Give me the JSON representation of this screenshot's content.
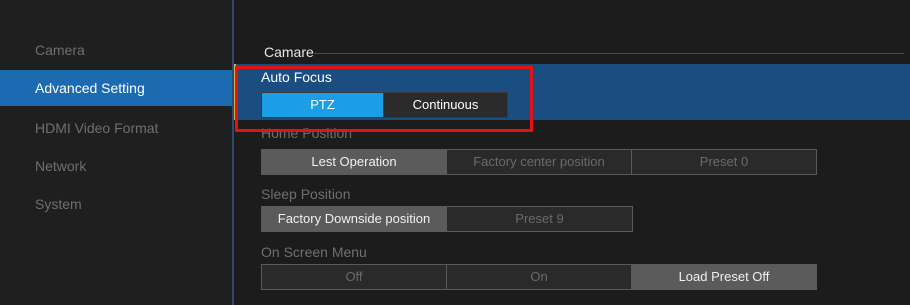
{
  "sidebar": {
    "items": [
      {
        "label": "Camera"
      },
      {
        "label": "Advanced Setting"
      },
      {
        "label": "HDMI Video Format"
      },
      {
        "label": "Network"
      },
      {
        "label": "System"
      }
    ]
  },
  "main": {
    "section_title": "Camare",
    "auto_focus": {
      "label": "Auto Focus",
      "options": [
        "PTZ",
        "Continuous"
      ],
      "selected": "PTZ"
    },
    "home_position": {
      "label": "Home Position",
      "options": [
        "Lest Operation",
        "Factory center position",
        "Preset  0"
      ],
      "selected": "Lest Operation"
    },
    "sleep_position": {
      "label": "Sleep Position",
      "options": [
        "Factory Downside position",
        "Preset  9"
      ],
      "selected": "Factory Downside position"
    },
    "on_screen_menu": {
      "label": "On Screen Menu",
      "options": [
        "Off",
        "On",
        "Load Preset Off"
      ],
      "selected": "Load Preset Off"
    }
  },
  "colors": {
    "active_nav": "#1c6bb0",
    "focus_band": "#1b4e80",
    "selected_blue": "#1b9ee6",
    "highlight_red": "#e01414"
  }
}
